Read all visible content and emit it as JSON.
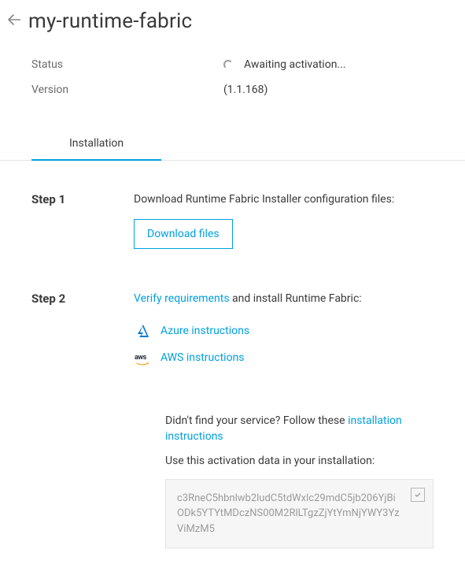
{
  "header": {
    "title": "my-runtime-fabric"
  },
  "meta": {
    "status_label": "Status",
    "status_value": "Awaiting activation...",
    "version_label": "Version",
    "version_value": "(1.1.168)"
  },
  "tabs": {
    "installation": "Installation"
  },
  "step1": {
    "label": "Step 1",
    "text": "Download Runtime Fabric Installer configuration files:",
    "button": "Download files"
  },
  "step2": {
    "label": "Step 2",
    "verify_link": "Verify requirements",
    "verify_suffix": " and install Runtime Fabric:",
    "azure_link": "Azure instructions",
    "aws_link": "AWS instructions"
  },
  "footer": {
    "not_found_prefix": "Didn't find your service? Follow these ",
    "not_found_link": "installation instructions",
    "activation_label": "Use this activation data in your installation:",
    "activation_code": "c3RneC5hbnlwb2ludC5tdWxlc29mdC5jb206YjBiODk5YTYtMDczNS00M2RlLTgzZjYtYmNjYWY3YzViMzM5"
  }
}
